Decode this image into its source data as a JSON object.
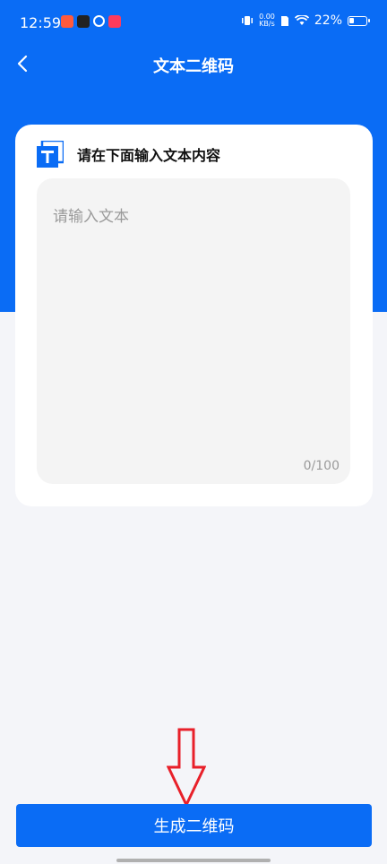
{
  "status_bar": {
    "time": "12:59",
    "speed_value": "0.00",
    "speed_unit": "KB/s",
    "battery": "22%"
  },
  "header": {
    "title": "文本二维码"
  },
  "card": {
    "title": "请在下面输入文本内容",
    "input_placeholder": "请输入文本",
    "input_value": "",
    "counter": "0/100"
  },
  "footer": {
    "generate_label": "生成二维码"
  },
  "colors": {
    "primary": "#0a6cf5",
    "background": "#f4f5f9",
    "arrow": "#e8202a"
  }
}
